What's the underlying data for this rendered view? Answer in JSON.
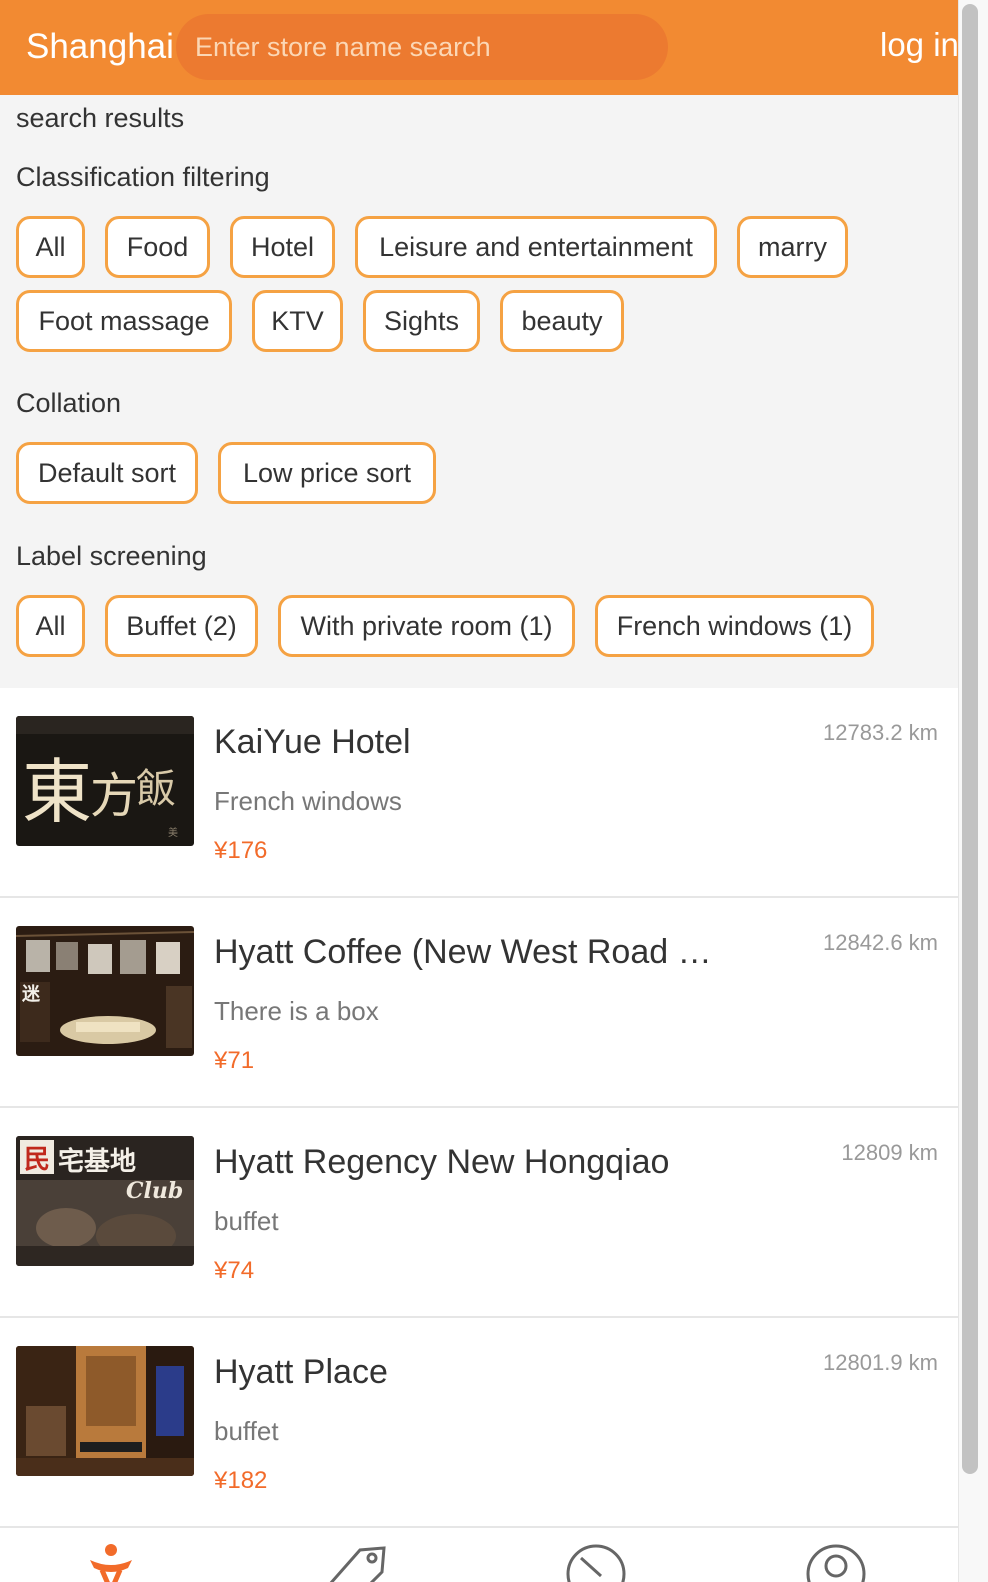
{
  "header": {
    "city": "Shanghai",
    "search_placeholder": "Enter store name search",
    "login": "log in",
    "color": "#f28a32"
  },
  "filters": {
    "title": "search results",
    "classification": {
      "label": "Classification filtering",
      "options": [
        "All",
        "Food",
        "Hotel",
        "Leisure and entertainment",
        "marry",
        "Foot massage",
        "KTV",
        "Sights",
        "beauty"
      ]
    },
    "collation": {
      "label": "Collation",
      "options": [
        "Default sort",
        "Low price sort"
      ]
    },
    "labels": {
      "label": "Label screening",
      "options": [
        "All",
        "Buffet (2)",
        "With private room (1)",
        "French windows (1)"
      ]
    },
    "chip_border_color": "#f5a243"
  },
  "listings": [
    {
      "name": "KaiYue Hotel",
      "tag": "French windows",
      "price": "¥176",
      "distance": "12783.2 km"
    },
    {
      "name": "Hyatt Coffee (New West Road Shop)",
      "tag": "There is a box",
      "price": "¥71",
      "distance": "12842.6 km"
    },
    {
      "name": "Hyatt Regency New Hongqiao",
      "tag": "buffet",
      "price": "¥74",
      "distance": "12809 km"
    },
    {
      "name": "Hyatt Place",
      "tag": "buffet",
      "price": "¥182",
      "distance": "12801.9 km"
    }
  ],
  "price_color": "#f26b2a",
  "bottom_nav": {
    "icons": [
      "home-person-icon",
      "coupon-tag-icon",
      "compass-icon",
      "user-profile-icon"
    ]
  }
}
